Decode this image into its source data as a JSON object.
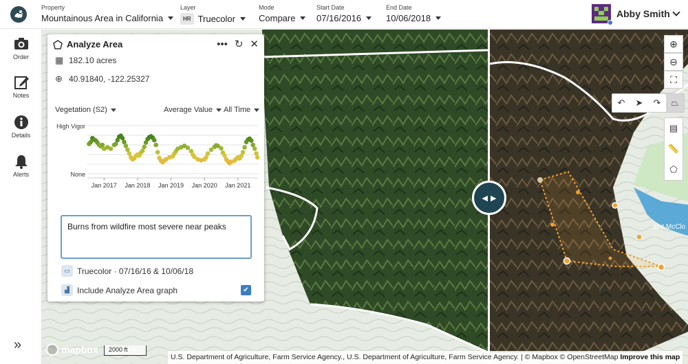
{
  "header": {
    "property_label": "Property",
    "property_value": "Mountainous Area in California",
    "layer_label": "Layer",
    "layer_badge": "HR",
    "layer_value": "Truecolor",
    "mode_label": "Mode",
    "mode_value": "Compare",
    "start_label": "Start Date",
    "start_value": "07/16/2016",
    "end_label": "End Date",
    "end_value": "10/06/2018",
    "user_name": "Abby Smith"
  },
  "sidebar": {
    "items": [
      {
        "label": "Order",
        "icon": "camera-icon"
      },
      {
        "label": "Notes",
        "icon": "edit-icon"
      },
      {
        "label": "Details",
        "icon": "info-icon"
      },
      {
        "label": "Alerts",
        "icon": "bell-icon"
      }
    ],
    "expand_icon": "»"
  },
  "panel": {
    "title": "Analyze Area",
    "area": "182.10 acres",
    "coords": "40.91840, -122.25327",
    "index_select": "Vegetation (S2)",
    "stat_select": "Average Value",
    "range_select": "All Time",
    "note_text": "Burns from wildfire most severe near peaks",
    "layer_info": "Truecolor · 07/16/16 & 10/06/18",
    "include_graph_label": "Include Analyze Area graph",
    "include_graph_checked": true
  },
  "chart_data": {
    "type": "scatter",
    "ylabel_top": "High Vigor",
    "ylabel_bottom": "None",
    "x_ticks": [
      "Jan 2017",
      "Jan 2018",
      "Jan 2019",
      "Jan 2020",
      "Jan 2021"
    ],
    "x_range": [
      2016.5,
      2021.6
    ],
    "y_range": [
      0,
      1
    ],
    "points": [
      [
        2016.55,
        0.62
      ],
      [
        2016.6,
        0.66
      ],
      [
        2016.65,
        0.74
      ],
      [
        2016.7,
        0.71
      ],
      [
        2016.75,
        0.69
      ],
      [
        2016.8,
        0.65
      ],
      [
        2016.85,
        0.6
      ],
      [
        2016.9,
        0.57
      ],
      [
        2016.95,
        0.6
      ],
      [
        2017.0,
        0.52
      ],
      [
        2017.1,
        0.55
      ],
      [
        2017.2,
        0.52
      ],
      [
        2017.3,
        0.6
      ],
      [
        2017.35,
        0.62
      ],
      [
        2017.4,
        0.7
      ],
      [
        2017.45,
        0.77
      ],
      [
        2017.5,
        0.79
      ],
      [
        2017.55,
        0.74
      ],
      [
        2017.6,
        0.66
      ],
      [
        2017.65,
        0.58
      ],
      [
        2017.7,
        0.5
      ],
      [
        2017.75,
        0.42
      ],
      [
        2017.8,
        0.34
      ],
      [
        2017.85,
        0.3
      ],
      [
        2017.9,
        0.32
      ],
      [
        2017.95,
        0.37
      ],
      [
        2018.0,
        0.4
      ],
      [
        2018.05,
        0.38
      ],
      [
        2018.1,
        0.44
      ],
      [
        2018.15,
        0.48
      ],
      [
        2018.2,
        0.56
      ],
      [
        2018.25,
        0.65
      ],
      [
        2018.3,
        0.72
      ],
      [
        2018.35,
        0.76
      ],
      [
        2018.4,
        0.78
      ],
      [
        2018.45,
        0.75
      ],
      [
        2018.5,
        0.7
      ],
      [
        2018.55,
        0.6
      ],
      [
        2018.6,
        0.45
      ],
      [
        2018.65,
        0.33
      ],
      [
        2018.7,
        0.27
      ],
      [
        2018.75,
        0.24
      ],
      [
        2018.8,
        0.27
      ],
      [
        2018.85,
        0.3
      ],
      [
        2018.95,
        0.34
      ],
      [
        2019.05,
        0.36
      ],
      [
        2019.1,
        0.42
      ],
      [
        2019.15,
        0.47
      ],
      [
        2019.2,
        0.52
      ],
      [
        2019.3,
        0.55
      ],
      [
        2019.4,
        0.58
      ],
      [
        2019.5,
        0.54
      ],
      [
        2019.6,
        0.47
      ],
      [
        2019.65,
        0.4
      ],
      [
        2019.7,
        0.35
      ],
      [
        2019.8,
        0.3
      ],
      [
        2019.9,
        0.28
      ],
      [
        2020.0,
        0.3
      ],
      [
        2020.05,
        0.34
      ],
      [
        2020.1,
        0.42
      ],
      [
        2020.2,
        0.5
      ],
      [
        2020.3,
        0.56
      ],
      [
        2020.35,
        0.59
      ],
      [
        2020.4,
        0.58
      ],
      [
        2020.5,
        0.53
      ],
      [
        2020.55,
        0.44
      ],
      [
        2020.6,
        0.38
      ],
      [
        2020.65,
        0.3
      ],
      [
        2020.7,
        0.26
      ],
      [
        2020.75,
        0.22
      ],
      [
        2020.8,
        0.25
      ],
      [
        2020.9,
        0.27
      ],
      [
        2020.95,
        0.31
      ],
      [
        2021.0,
        0.34
      ],
      [
        2021.05,
        0.32
      ],
      [
        2021.1,
        0.37
      ],
      [
        2021.15,
        0.45
      ],
      [
        2021.2,
        0.55
      ],
      [
        2021.25,
        0.66
      ],
      [
        2021.3,
        0.71
      ],
      [
        2021.35,
        0.73
      ],
      [
        2021.4,
        0.69
      ],
      [
        2021.45,
        0.6
      ],
      [
        2021.5,
        0.52
      ],
      [
        2021.55,
        0.42
      ],
      [
        2021.58,
        0.34
      ]
    ]
  },
  "map": {
    "attribution": "U.S. Department of Agriculture, Farm Service Agency., U.S. Department of Agriculture, Farm Service Agency. | © Mapbox © OpenStreetMap",
    "improve": "Improve this map",
    "mapbox_label": "mapbox",
    "scale_label": "2000 ft",
    "place_label": "aint McClo"
  },
  "colors": {
    "brand": "#2e4a55",
    "accent": "#3c7dc4",
    "drawing": "#f0a030"
  }
}
